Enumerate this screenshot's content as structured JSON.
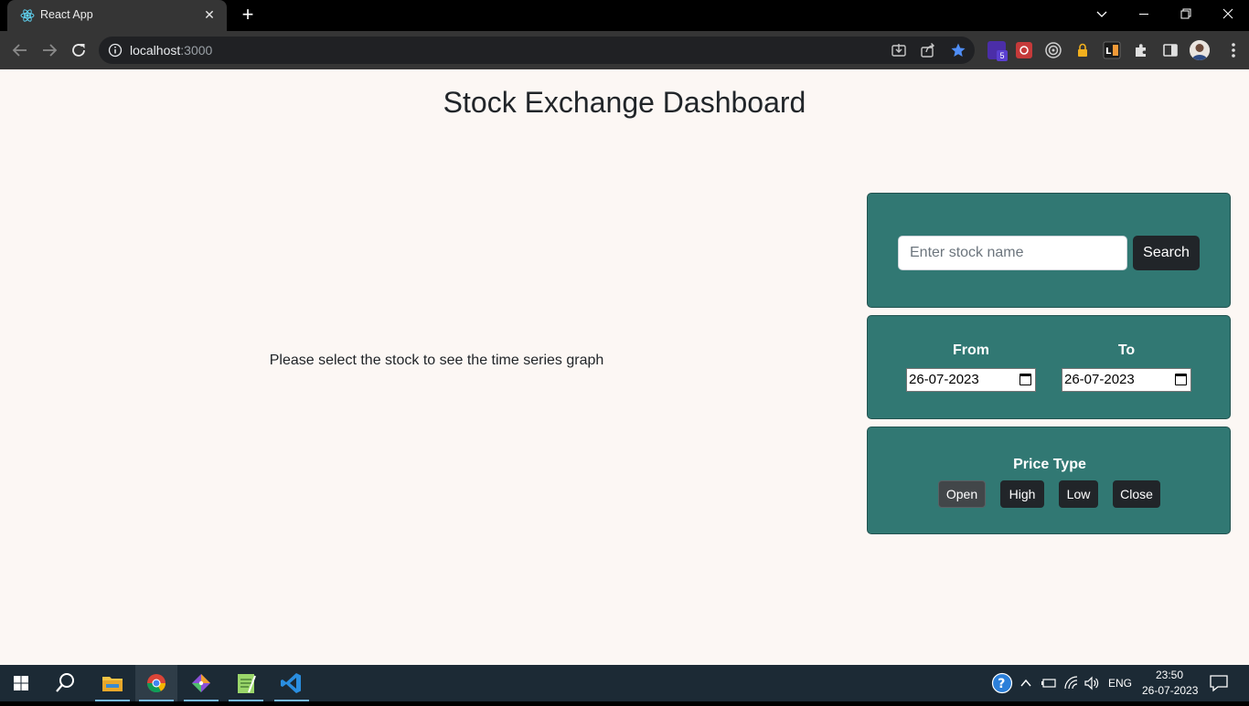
{
  "browser": {
    "tab_title": "React App",
    "url_host": "localhost",
    "url_port": ":3000",
    "extension_badge": "5"
  },
  "page": {
    "title": "Stock Exchange Dashboard",
    "empty_message": "Please select the stock to see the time series graph",
    "search": {
      "placeholder": "Enter stock name",
      "value": "",
      "button_label": "Search"
    },
    "dates": {
      "from_label": "From",
      "from_value": "26-07-2023",
      "to_label": "To",
      "to_value": "26-07-2023"
    },
    "price_type": {
      "label": "Price Type",
      "options": [
        "Open",
        "High",
        "Low",
        "Close"
      ],
      "selected": "Open"
    }
  },
  "taskbar": {
    "language": "ENG",
    "time": "23:50",
    "date": "26-07-2023"
  },
  "colors": {
    "panel": "#317873",
    "button_dark": "#212529",
    "page_bg": "#fcf7f4"
  }
}
